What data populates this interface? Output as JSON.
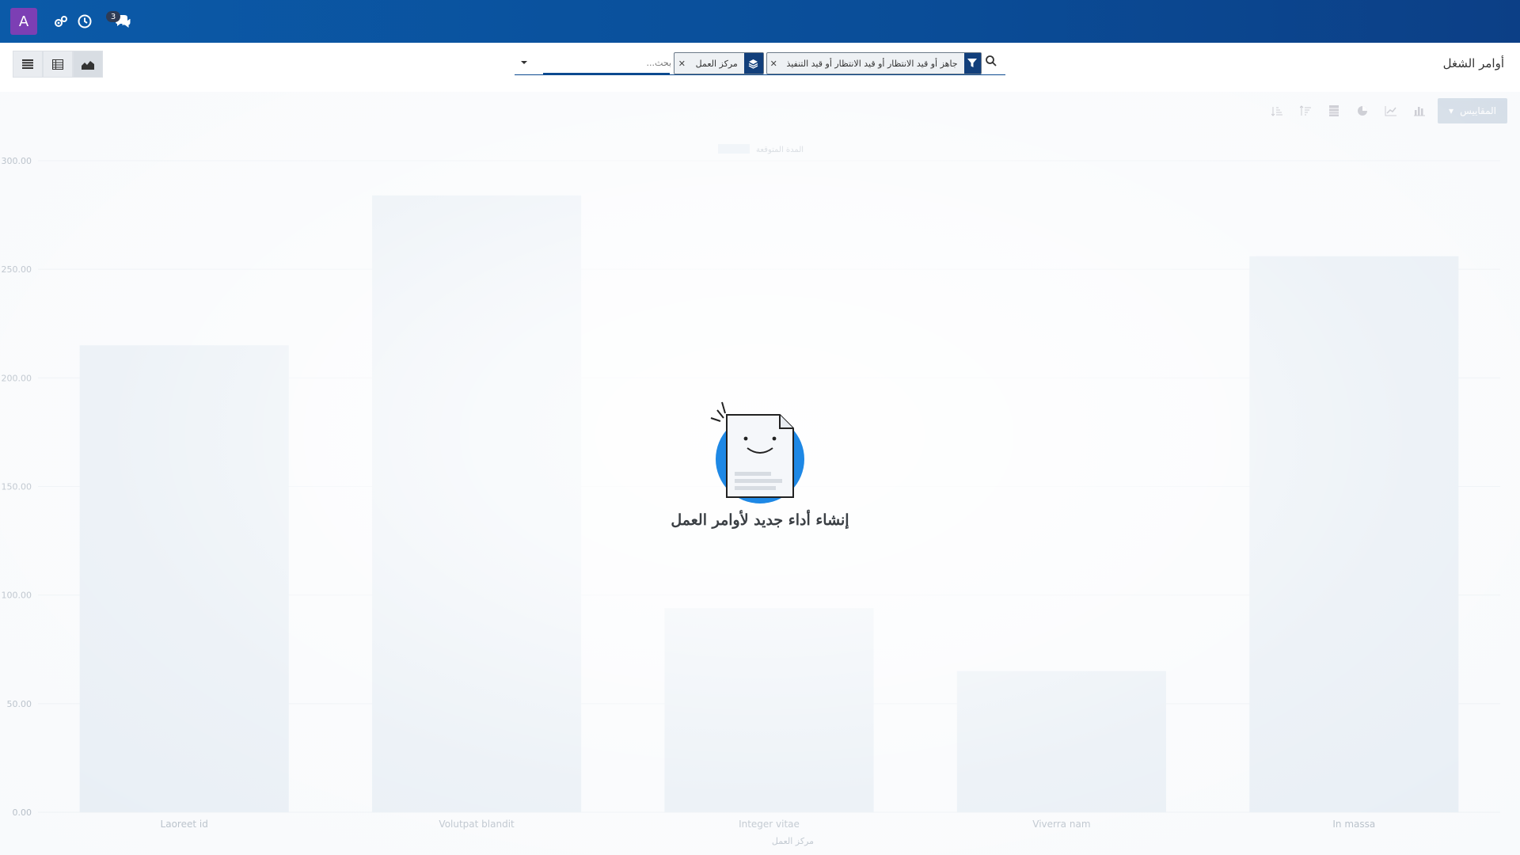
{
  "navbar": {
    "avatar_letter": "A",
    "icons": [
      "activities-icon",
      "clock-icon",
      "chat-icon"
    ],
    "messages_count": "3",
    "color": "#0b5aa8"
  },
  "control_panel": {
    "title": "أوامر الشغل",
    "search": {
      "placeholder": "بحث...",
      "facets": [
        {
          "icon": "filter-icon",
          "label": "جاهز أو قيد الانتظار أو قيد الانتظار أو قيد التنفيذ"
        },
        {
          "icon": "group-by-icon",
          "label": "مركز العمل"
        }
      ]
    },
    "views": [
      "list-view",
      "pivot-view",
      "graph-view"
    ],
    "active_view": "graph-view"
  },
  "graph_toolbar": {
    "measures_label": "المقاييس",
    "icons": [
      "bar-chart-icon",
      "line-chart-icon",
      "pie-chart-icon",
      "database-icon",
      "sort-descending-icon",
      "sort-ascending-icon"
    ]
  },
  "chart_data": {
    "type": "bar",
    "categories": [
      "Laoreet id",
      "Volutpat blandit",
      "Integer vitae",
      "Viverra nam",
      "In massa"
    ],
    "series": [
      {
        "name": "المدة المتوقعة",
        "values": [
          215,
          284,
          94,
          65,
          256
        ]
      }
    ],
    "yticks": [
      "0.00",
      "50.00",
      "100.00",
      "150.00",
      "200.00",
      "250.00",
      "300.00"
    ],
    "ylim": [
      0,
      300
    ],
    "xlabel": "مركز العمل",
    "ylabel": "",
    "grid": true,
    "legend_position": "top-center",
    "bar_color": "#dfe8f1"
  },
  "empty_state": {
    "title": "إنشاء أداء جديد لأوامر العمل"
  }
}
